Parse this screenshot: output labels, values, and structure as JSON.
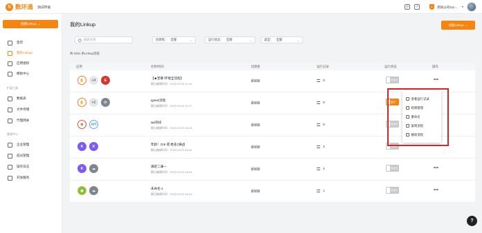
{
  "header": {
    "logo_mark": "S",
    "logo_text": "数环通",
    "env": "测试环境",
    "company": "测试公司111...",
    "icons": [
      "clock-icon",
      "export-icon",
      "bell-icon"
    ]
  },
  "sidebar": {
    "create_label": "创建Linkup →",
    "sections": [
      {
        "title": "",
        "items": [
          {
            "label": "首页",
            "icon": "home-icon"
          },
          {
            "label": "我的Linkup",
            "icon": "linkup-icon",
            "active": true
          },
          {
            "label": "应用授权",
            "icon": "authorize-icon"
          },
          {
            "label": "模板中心",
            "icon": "template-icon"
          }
        ]
      },
      {
        "title": "扩展工具",
        "items": [
          {
            "label": "数据表",
            "icon": "table-icon"
          },
          {
            "label": "文件存储",
            "icon": "file-icon"
          },
          {
            "label": "代理网关",
            "icon": "gateway-icon"
          }
        ]
      },
      {
        "title": "管理中心",
        "items": [
          {
            "label": "企业管理",
            "icon": "company-icon"
          },
          {
            "label": "成员管理",
            "icon": "member-icon"
          },
          {
            "label": "操作日志",
            "icon": "log-icon"
          },
          {
            "label": "开发服务",
            "icon": "dev-icon"
          }
        ]
      }
    ]
  },
  "main": {
    "title": "我的Linkup",
    "create_label": "创建Linkup →",
    "search_placeholder": "搜索名称",
    "filters": [
      {
        "label": "创建者：",
        "value": "全部"
      },
      {
        "label": "运行状态：",
        "value": "全部"
      },
      {
        "label": "类型：",
        "value": "全部"
      }
    ],
    "total": "共 1001 条Linkup流程",
    "columns": [
      "应用",
      "名称/时间",
      "创建者",
      "运行记录",
      "运行状态",
      "操作"
    ],
    "rows": [
      {
        "name": "【★至尊-环境全流程】",
        "updated": "最后编辑时间：2023-03-24 11:34",
        "creator": "郎郎郎",
        "records": "0",
        "status": "未运行",
        "on": false,
        "extra": "+4"
      },
      {
        "name": "qytest流程",
        "updated": "最后编辑时间：2023-03-24 11:27",
        "creator": "郎郎郎",
        "records": "0",
        "status": "运行",
        "on": true,
        "extra": "+2"
      },
      {
        "name": "api测试",
        "updated": "最后编辑时间：2023-03-23 16:44",
        "creator": "郎郎郎",
        "records": "0",
        "status": "未运行",
        "on": false,
        "extra": ""
      },
      {
        "name": "年龄！≠18 或 姓名≠满战",
        "updated": "最后编辑时间：2023-03-23 16:44",
        "creator": "郎郎郎",
        "records": "3",
        "status": "未运行",
        "on": false,
        "extra": ""
      },
      {
        "name": "满足二满一",
        "updated": "最后编辑时间：2023-03-23 16:44",
        "creator": "郎郎郎",
        "records": "4",
        "status": "未运行",
        "on": false,
        "extra": ""
      },
      {
        "name": "未命名-1",
        "updated": "最后编辑时间：2023-03-23 16:43",
        "creator": "郎郎郎",
        "records": "1",
        "status": "未运行",
        "on": false,
        "extra": ""
      }
    ],
    "more": "•••"
  },
  "dropdown": {
    "items": [
      "查看运行记录",
      "权限管理",
      "重命名",
      "复制流程",
      "删除流程"
    ]
  },
  "help": "?",
  "colors": {
    "accent": "#f7850d",
    "highlight": "#e02020"
  }
}
